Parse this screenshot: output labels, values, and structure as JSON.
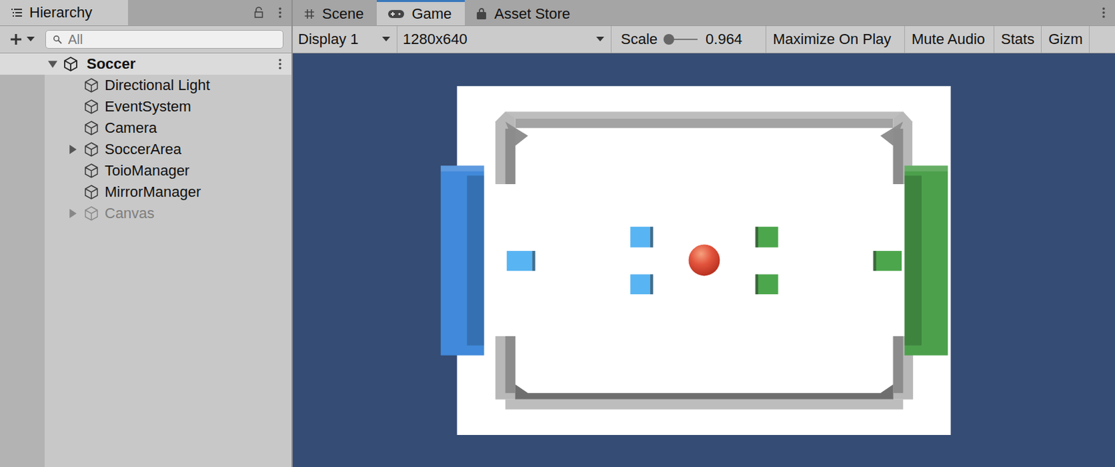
{
  "hierarchy": {
    "title": "Hierarchy",
    "search": {
      "placeholder": "All"
    },
    "scene": {
      "name": "Soccer",
      "expanded": true
    },
    "items": [
      {
        "label": "Directional Light",
        "expandable": false,
        "expanded": false,
        "disabled": false
      },
      {
        "label": "EventSystem",
        "expandable": false,
        "expanded": false,
        "disabled": false
      },
      {
        "label": "Camera",
        "expandable": false,
        "expanded": false,
        "disabled": false
      },
      {
        "label": "SoccerArea",
        "expandable": true,
        "expanded": false,
        "disabled": false
      },
      {
        "label": "ToioManager",
        "expandable": false,
        "expanded": false,
        "disabled": false
      },
      {
        "label": "MirrorManager",
        "expandable": false,
        "expanded": false,
        "disabled": false
      },
      {
        "label": "Canvas",
        "expandable": true,
        "expanded": false,
        "disabled": true
      }
    ]
  },
  "tabs": [
    {
      "label": "Scene",
      "selected": false
    },
    {
      "label": "Game",
      "selected": true
    },
    {
      "label": "Asset Store",
      "selected": false
    }
  ],
  "toolbar": {
    "display": "Display 1",
    "resolution": "1280x640",
    "scale_label": "Scale",
    "scale_value": "0.964",
    "scale_level": 0.02,
    "buttons": [
      "Maximize On Play",
      "Mute Audio",
      "Stats",
      "Gizm"
    ]
  },
  "game": {
    "goals": [
      {
        "color": "#4189DA"
      },
      {
        "color": "#4CA04C"
      }
    ],
    "ball": {
      "color": "#E2533C"
    },
    "players": [
      {
        "color": "#58B4F2"
      },
      {
        "color": "#58B4F2"
      },
      {
        "color": "#58B4F2"
      },
      {
        "color": "#4CA64C"
      },
      {
        "color": "#4CA64C"
      },
      {
        "color": "#4CA64C"
      }
    ]
  }
}
